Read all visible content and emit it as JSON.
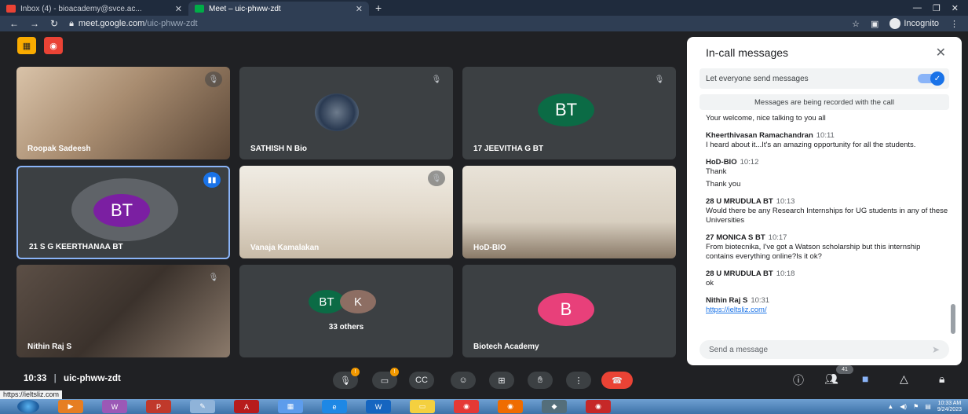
{
  "browser": {
    "tabs": [
      {
        "title": "Inbox (4) - bioacademy@svce.ac...",
        "active": false
      },
      {
        "title": "Meet – uic-phww-zdt",
        "active": true
      }
    ],
    "url_host": "meet.google.com",
    "url_path": "/uic-phww-zdt",
    "incognito_label": "Incognito"
  },
  "tiles": [
    {
      "name": "Roopak Sadeesh",
      "type": "video"
    },
    {
      "name": "SATHISH N Bio",
      "type": "photo"
    },
    {
      "name": "17 JEEVITHA G BT",
      "type": "initials",
      "initials": "BT",
      "color": "#0b6b45"
    },
    {
      "name": "21 S G KEERTHANAA BT",
      "type": "initials",
      "initials": "BT",
      "color": "#7b1fa2"
    },
    {
      "name": "Vanaja Kamalakan",
      "type": "video"
    },
    {
      "name": "HoD-BIO",
      "type": "video"
    },
    {
      "name": "Nithin Raj S",
      "type": "video"
    },
    {
      "name": "33 others",
      "type": "group",
      "initials": [
        "BT",
        "K"
      ],
      "colors": [
        "#0b6b45",
        "#8d6e63"
      ]
    },
    {
      "name": "Biotech Academy",
      "type": "initials",
      "initials": "B",
      "color": "#e8407a"
    }
  ],
  "chat": {
    "title": "In-call messages",
    "toggle_label": "Let everyone send messages",
    "record_note": "Messages are being recorded with the call",
    "first_line": "Your welcome, nice talking to you all",
    "messages": [
      {
        "sender": "Kheerthivasan Ramachandran",
        "time": "10:11",
        "lines": [
          "I heard about it...It's an amazing opportunity for all the students."
        ]
      },
      {
        "sender": "HoD-BIO",
        "time": "10:12",
        "lines": [
          "Thank",
          "Thank you"
        ]
      },
      {
        "sender": "28 U MRUDULA BT",
        "time": "10:13",
        "lines": [
          "Would there be any Research Internships for UG students in any of these Universities"
        ]
      },
      {
        "sender": "27 MONICA S BT",
        "time": "10:17",
        "lines": [
          "From biotecnika, I've got a Watson scholarship but this internship contains everything online?Is it ok?"
        ]
      },
      {
        "sender": "28 U MRUDULA BT",
        "time": "10:18",
        "lines": [
          "ok"
        ]
      },
      {
        "sender": "Nithin Raj S",
        "time": "10:31",
        "lines": []
      }
    ],
    "link": "https://ieltsliz.com/",
    "input_placeholder": "Send a message"
  },
  "meeting": {
    "time": "10:33",
    "code": "uic-phww-zdt",
    "participant_count": "41"
  },
  "status_url": "https://ieltsliz.com",
  "taskbar": {
    "clock_time": "10:33 AM",
    "clock_date": "9/24/2023"
  },
  "colors": {
    "accent": "#1a73e8",
    "hangup": "#ea4335",
    "tile_bg": "#3c4043",
    "stage_bg": "#202124"
  }
}
